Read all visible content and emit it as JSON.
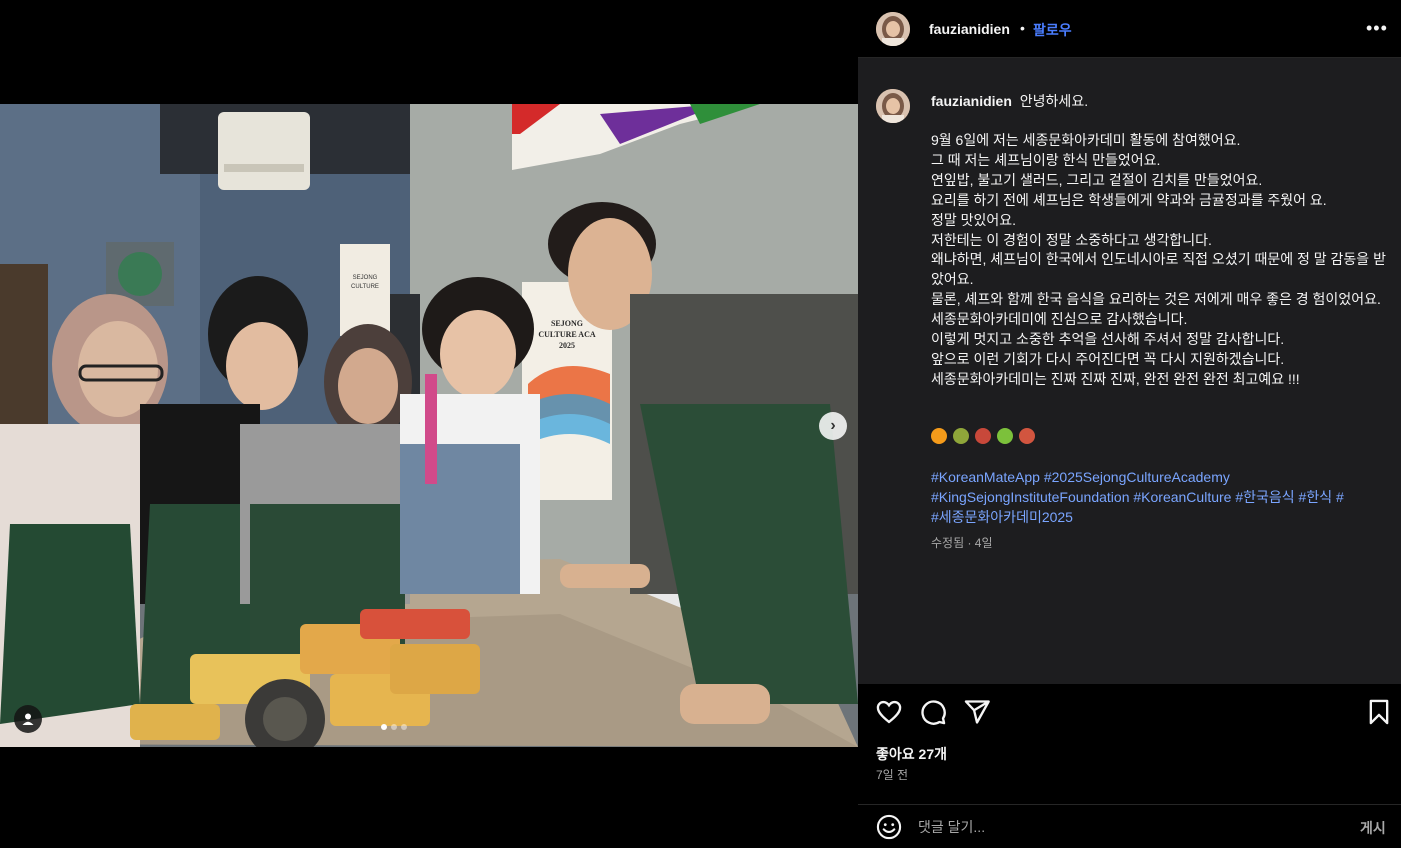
{
  "post": {
    "author": "fauzianidien",
    "separator": "•",
    "follow_label": "팔로우",
    "more_label": "•••"
  },
  "caption": {
    "greeting": "안녕하세요.",
    "lines": [
      "9월 6일에 저는 세종문화아카데미 활동에 참여했어요.",
      "그 때 저는 셰프님이랑 한식 만들었어요.",
      "연잎밥, 불고기 샐러드, 그리고 겉절이 김치를 만들었어요.",
      "요리를 하기 전에 셰프님은 학생들에게 약과와 금귤정과를 주웠어 요.",
      "정말 맛있어요.",
      "저한테는 이 경험이 정말 소중하다고 생각합니다.",
      "왜냐하면, 셰프님이 한국에서 인도네시아로 직접 오셨기 때문에 정 말 감동을 받았어요.",
      "물론, 셰프와 함께 한국 음식을 요리하는 것은 저에게 매우 좋은 경 험이었어요.",
      "세종문화아카데미에 진심으로 감사했습니다.",
      "이렇게 멋지고 소중한 추억을 선사해 주셔서 정말 감사합니다.",
      "앞으로 이런 기회가 다시 주어진다면 꼭 다시 지원하겠습니다.",
      "세종문화아카데미는 진짜 진짜 진짜, 완전 완전 완전 최고예요 !!!"
    ],
    "emoji_icons": [
      "tangerine-icon",
      "kiwi-icon",
      "bacon-icon",
      "kiwi-slice-icon",
      "bowl-icon"
    ],
    "emoji_colors": [
      "#f59b1a",
      "#8fa63a",
      "#c8483a",
      "#7cc13b",
      "#d2553f"
    ],
    "hashtags": [
      "#KoreanMateApp",
      "#2025SejongCultureAcademy",
      "#KingSejongInstituteFoundation",
      "#KoreanCulture",
      "#한국음식",
      "#한식",
      "#세종문화아카데미2025"
    ],
    "edited_meta": "수정됨 · 4일"
  },
  "engagement": {
    "likes": "좋아요 27개",
    "posted": "7일 전"
  },
  "comment": {
    "placeholder": "댓글 달기...",
    "post_label": "게시"
  },
  "photo": {
    "poster_text": "SEJONG\nCULTURE ACADEMY\n2025",
    "apron_text": "SEJONG\nCULTURE ACADEMY",
    "carousel_count": 3,
    "carousel_active": 1
  },
  "colors": {
    "accent_blue": "#4a7dff",
    "hashtag_blue": "#7aa5ff",
    "panel_bg": "#1d1d1f",
    "muted": "#a8a8a8"
  }
}
